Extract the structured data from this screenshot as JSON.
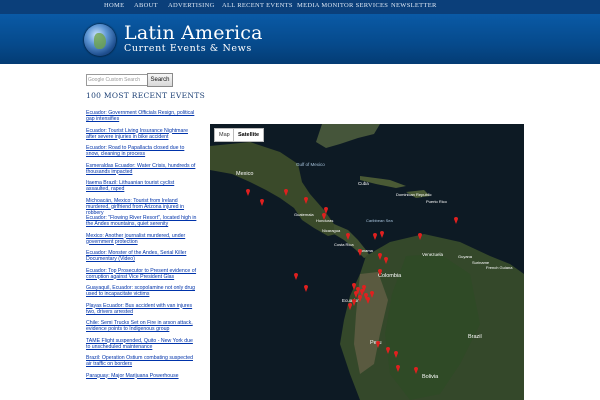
{
  "nav": {
    "items": [
      {
        "label": "HOME"
      },
      {
        "label": "ABOUT"
      },
      {
        "label": "ADVERTISING"
      },
      {
        "label": "ALL RECENT EVENTS"
      },
      {
        "label": "MEDIA MONITOR SERVICES"
      },
      {
        "label": "NEWSLETTER"
      }
    ]
  },
  "site": {
    "title": "Latin America",
    "subtitle": "Current Events & News"
  },
  "search": {
    "placeholder": "Google Custom Search",
    "button_label": "Search"
  },
  "events": {
    "heading": "100 MOST RECENT EVENTS",
    "items": [
      {
        "label": "Ecuador: Government Officials Resign, political gap intensifies"
      },
      {
        "label": "Ecuador: Tourist Living Insurance Nightmare after severe injuries in bike accident"
      },
      {
        "label": "Ecuador: Road to Papallacta closed due to snow, cleaning in process"
      },
      {
        "label": "Esmeraldas Ecuador: Water Crisis, hundreds of thousands impacted"
      },
      {
        "label": "Itaema Brazil: Lithuanian tourist cyclist assaulted, raped"
      },
      {
        "label": "Michoacán, Mexico: Tourist from Ireland murdered, girlfriend from Arizona injured in robbery"
      },
      {
        "label": "Ecuador: \"Flowing River Resort\", located high in the Andes mountains, quiet serenity"
      },
      {
        "label": "Mexico: Another journalist murdered, under government protection"
      },
      {
        "label": "Ecuador: Monster of the Andes, Serial Killer Documentary (Video)"
      },
      {
        "label": "Ecuador: Top Prosecutor to Present evidence of corruption against Vice President Glas"
      },
      {
        "label": "Guayaquil, Ecuador: scopolamine not only drug used to incapacitate victims"
      },
      {
        "label": "Playas Ecuador: Bus accident with van injures two, drivers arrested"
      },
      {
        "label": "Chile: Semi Trucks Set on Fire in arson attack, evidence points to Indigenous group"
      },
      {
        "label": "TAME Flight suspended, Quito - New York due to unscheduled maintenance"
      },
      {
        "label": "Brazil: Operation Ostium combating suspected air traffic on borders"
      },
      {
        "label": "Paraguay: Major Marijuana Powerhouse"
      }
    ]
  },
  "map": {
    "type_controls": [
      {
        "label": "Map",
        "active": false
      },
      {
        "label": "Satellite",
        "active": true
      }
    ],
    "labels": [
      "Mexico",
      "Gulf of Mexico",
      "Cuba",
      "Dominican Republic",
      "Puerto Rico",
      "Guatemala",
      "Honduras",
      "Nicaragua",
      "Caribbean Sea",
      "Costa Rica",
      "Panama",
      "Venezuela",
      "Guyana",
      "Suriname",
      "French Guiana",
      "Colombia",
      "Ecuador",
      "Peru",
      "Brazil",
      "Bolivia"
    ],
    "colors": {
      "ocean": "#0d1a24",
      "land": "#3a4a2a",
      "marker": "#e0201f"
    }
  }
}
